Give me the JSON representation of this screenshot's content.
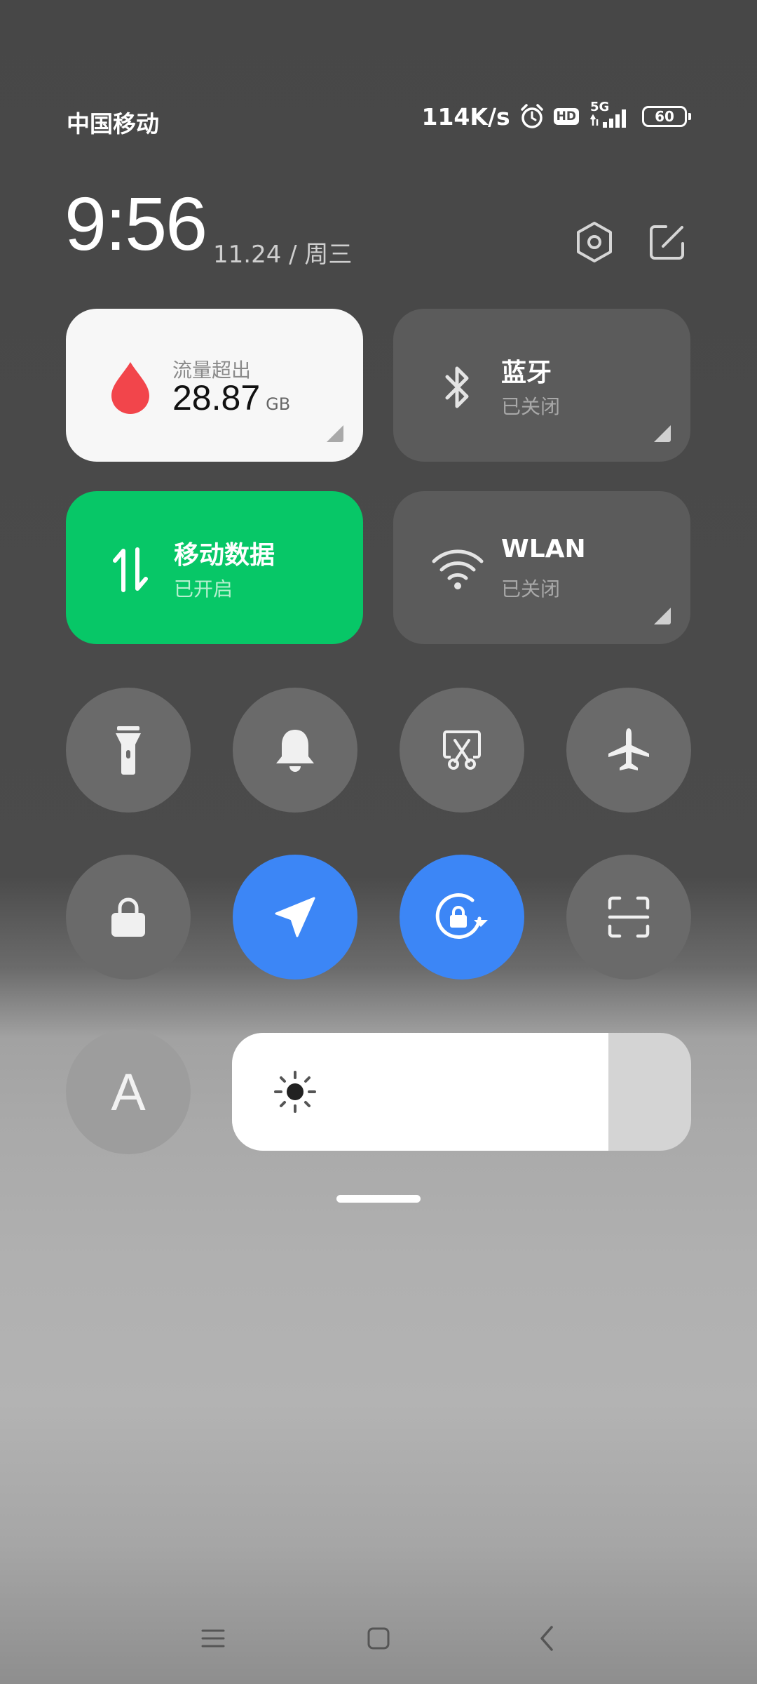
{
  "status_bar": {
    "carrier": "中国移动",
    "net_speed": "114K/s",
    "hd": "HD",
    "network_gen": "5G",
    "battery": "60"
  },
  "header": {
    "time": "9:56",
    "date": "11.24 / 周三",
    "settings_icon": "hexagon-gear-icon",
    "edit_icon": "edit-icon"
  },
  "tiles": {
    "data_usage": {
      "label": "流量超出",
      "value": "28.87",
      "unit": "GB",
      "color": "#f2454b"
    },
    "bluetooth": {
      "title": "蓝牙",
      "status": "已关闭"
    },
    "mobile_data": {
      "title": "移动数据",
      "status": "已开启",
      "color": "#07c767"
    },
    "wlan": {
      "title": "WLAN",
      "status": "已关闭"
    }
  },
  "toggles": [
    {
      "name": "flashlight",
      "icon": "flashlight-icon",
      "active": false
    },
    {
      "name": "mute",
      "icon": "bell-icon",
      "active": false
    },
    {
      "name": "screenshot",
      "icon": "scissors-screenshot-icon",
      "active": false
    },
    {
      "name": "airplane-mode",
      "icon": "airplane-icon",
      "active": false
    },
    {
      "name": "lock-screen",
      "icon": "lock-icon",
      "active": false
    },
    {
      "name": "location",
      "icon": "location-arrow-icon",
      "active": true
    },
    {
      "name": "rotation-lock",
      "icon": "rotation-lock-icon",
      "active": true
    },
    {
      "name": "scanner",
      "icon": "scan-icon",
      "active": false
    }
  ],
  "auto_brightness": {
    "label": "A"
  },
  "brightness": {
    "level": 0.82,
    "icon": "sun-icon"
  },
  "accent_color": "#3c86f6",
  "nav_bar": {
    "menu_icon": "menu-icon",
    "home_icon": "home-icon",
    "back_icon": "back-icon"
  }
}
